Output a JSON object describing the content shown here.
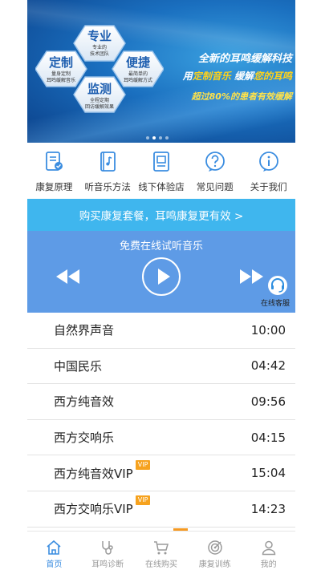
{
  "banner": {
    "hex": {
      "top": {
        "title": "专业",
        "sub1": "专业的",
        "sub2": "技术团队"
      },
      "left": {
        "title": "定制",
        "sub1": "量身定制",
        "sub2": "耳鸣缓解音乐"
      },
      "right": {
        "title": "便捷",
        "sub1": "最简单的",
        "sub2": "耳鸣缓解方式"
      },
      "bottom": {
        "title": "监测",
        "sub1": "全程定期",
        "sub2": "回访缓解效果"
      }
    },
    "slogan_line1": "全新的耳鸣缓解科技",
    "slogan_line2_a": "用",
    "slogan_line2_hl1": "定制音乐",
    "slogan_line2_b": " 缓解",
    "slogan_line2_hl2": "您的耳鸣",
    "slogan_line3": "超过80%的患者有效缓解",
    "carousel_index": 1,
    "carousel_count": 4
  },
  "nav": [
    {
      "label": "康复原理",
      "icon": "principle-icon"
    },
    {
      "label": "听音乐方法",
      "icon": "music-method-icon"
    },
    {
      "label": "线下体验店",
      "icon": "store-icon"
    },
    {
      "label": "常见问题",
      "icon": "question-icon"
    },
    {
      "label": "关于我们",
      "icon": "info-icon"
    }
  ],
  "promo": {
    "text": "购买康复套餐，耳鸣康复更有效 >"
  },
  "player": {
    "title": "免费在线试听音乐",
    "customer_service": "在线客服"
  },
  "tracks": [
    {
      "name": "自然界声音",
      "duration": "10:00",
      "vip": ""
    },
    {
      "name": "中国民乐",
      "duration": "04:42",
      "vip": ""
    },
    {
      "name": "西方纯音效",
      "duration": "09:56",
      "vip": ""
    },
    {
      "name": "西方交响乐",
      "duration": "04:15",
      "vip": ""
    },
    {
      "name": "西方纯音效VIP",
      "duration": "15:04",
      "vip": "VIP"
    },
    {
      "name": "西方交响乐VIP",
      "duration": "14:23",
      "vip": "VIP"
    }
  ],
  "tabs": [
    {
      "label": "首页",
      "icon": "home-icon",
      "active": true
    },
    {
      "label": "耳鸣诊断",
      "icon": "stethoscope-icon",
      "active": false
    },
    {
      "label": "在线购买",
      "icon": "cart-icon",
      "active": false
    },
    {
      "label": "康复训练",
      "icon": "target-icon",
      "active": false
    },
    {
      "label": "我的",
      "icon": "user-icon",
      "active": false
    }
  ],
  "colors": {
    "accent": "#3b8de0",
    "promo_bg": "#3fb6ee",
    "player_bg": "#5e9be6",
    "vip_badge": "#f6a21e",
    "slogan_highlight": "#ffd21a"
  }
}
